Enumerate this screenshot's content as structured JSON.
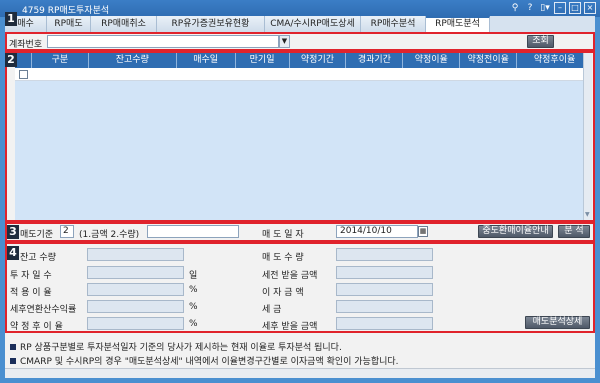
{
  "window": {
    "title": "4759 RP매도투자분석",
    "ctrl_pin": "⚲",
    "ctrl_help": "?",
    "ctrl_menu": "▯▾",
    "ctrl_min": "–",
    "ctrl_max": "□",
    "ctrl_close": "×"
  },
  "tabs": [
    "RP매수",
    "RP매도",
    "RP매매취소",
    "RP유가증권보유현황",
    "CMA/수시RP매도상세",
    "RP매수분석",
    "RP매도분석"
  ],
  "tabs_visible_first": "매수",
  "account": {
    "label": "계좌번호",
    "value": "",
    "query_button": "조회"
  },
  "grid": {
    "columns": [
      "구분",
      "잔고수량",
      "매수일",
      "만기일",
      "약정기간",
      "경과기간",
      "약정이율",
      "약정전이율",
      "약정후이율"
    ]
  },
  "criteria": {
    "label": "매도기준",
    "value": "2",
    "hint": "(1.금액 2.수량)",
    "input": "",
    "sell_date_label": "매 도 일 자",
    "sell_date": "2014/10/10",
    "guide_button": "중도환매이율안내",
    "analyze_button": "분 석"
  },
  "analysis": {
    "balance_qty_label": "잔고 수량",
    "invest_days_label": "투 자 일 수",
    "invest_days_unit": "일",
    "apply_rate_label": "적 용 이 율",
    "apply_rate_unit": "%",
    "pretax_yield_label": "세후연환산수익률",
    "pretax_yield_unit": "%",
    "contract_rate_label": "약 정 후 이 율",
    "contract_rate_unit": "%",
    "sell_qty_label": "매 도 수 량",
    "pretax_amount_label": "세전 받을 금액",
    "interest_label": "이 자 금 액",
    "tax_label": "세 금",
    "aftertax_amount_label": "세후 받을 금액",
    "detail_button": "매도분석상세"
  },
  "notes": [
    "RP 상품구분별로 투자분석일자 기준의 당사가 제시하는 현재 이율로 투자분석 됩니다.",
    "CMARP 및 수시RP의 경우 \"매도분석상세\" 내역에서 이율변경구간별로 이자금액 확인이 가능합니다."
  ],
  "markers": [
    "1",
    "2",
    "3",
    "4"
  ],
  "colors": {
    "accent": "#2f6db2",
    "highlight": "#e0232c",
    "grid_bg": "#d2e4f7"
  }
}
